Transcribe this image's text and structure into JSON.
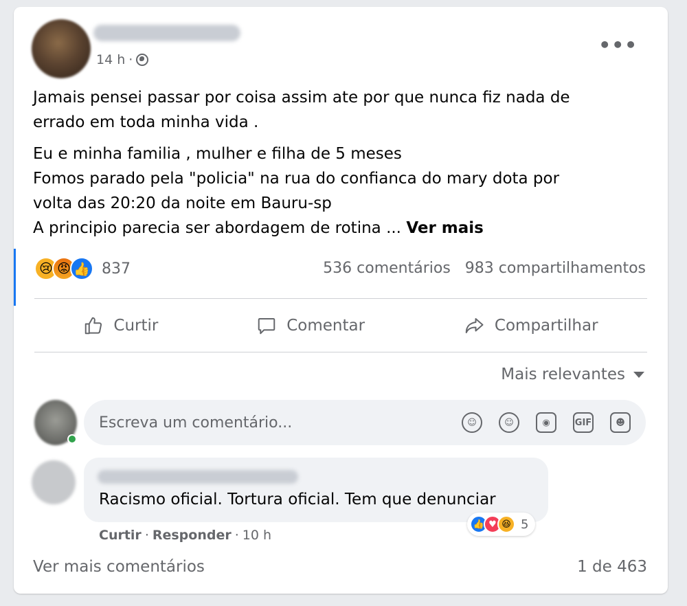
{
  "post": {
    "author_name": "",
    "time": "14 h",
    "separator": "·",
    "visibility_icon": "globe-icon",
    "more_icon": "•••",
    "text": {
      "line1": "Jamais pensei passar por coisa assim ate por que nunca fiz nada de",
      "line2": "errado em toda minha vida .",
      "line3": "Eu e minha familia , mulher e filha de 5 meses",
      "line4": "Fomos parado pela \"policia\" na rua do confianca do mary dota por",
      "line5": "volta das 20:20 da noite em Bauru-sp",
      "line6": "A principio parecia ser abordagem de rotina ...",
      "see_more": "Ver mais"
    },
    "reactions": {
      "icons": [
        "sad-reaction",
        "angry-reaction",
        "like-reaction"
      ],
      "count": "837"
    },
    "stats": {
      "comments": "536 comentários",
      "shares": "983 compartilhamentos"
    }
  },
  "actions": {
    "like": "Curtir",
    "comment": "Comentar",
    "share": "Compartilhar"
  },
  "sort": {
    "label": "Mais relevantes"
  },
  "comment_input": {
    "placeholder": "Escreva um comentário...",
    "icons": [
      "avatar-sticker-icon",
      "emoji-icon",
      "camera-icon",
      "gif-icon",
      "sticker-icon"
    ],
    "gif_label": "GIF"
  },
  "comment": {
    "author_name": "",
    "text": "Racismo oficial. Tortura oficial. Tem que denunciar",
    "reaction_icons": [
      "like-reaction",
      "love-reaction",
      "haha-reaction"
    ],
    "reaction_count": "5",
    "like_label": "Curtir",
    "reply_label": "Responder",
    "separator": "·",
    "time": "10 h"
  },
  "footer": {
    "more_comments": "Ver mais comentários",
    "pagination": "1 de 463"
  },
  "colors": {
    "accent": "#1877f2",
    "secondary_text": "#65676b",
    "bubble": "#f0f2f5"
  }
}
